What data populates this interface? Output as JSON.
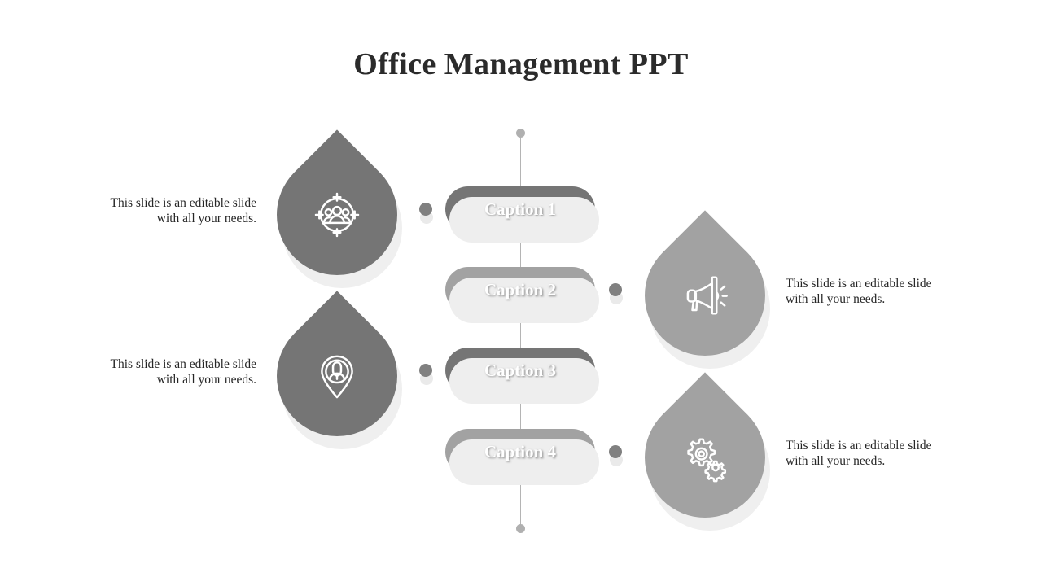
{
  "slide": {
    "title": "Office Management PPT",
    "background_color": "#ffffff",
    "title_color": "#2b2b2b",
    "accent_dark": "#757575",
    "accent_light": "#a2a2a2",
    "shadow_color": "#eeeeee",
    "spine_color": "#b4b4b4"
  },
  "captions": [
    {
      "label": "Caption 1",
      "tone": "dark",
      "color": "#757575"
    },
    {
      "label": "Caption 2",
      "tone": "light",
      "color": "#a2a2a2"
    },
    {
      "label": "Caption 3",
      "tone": "dark",
      "color": "#757575"
    },
    {
      "label": "Caption 4",
      "tone": "light",
      "color": "#a2a2a2"
    }
  ],
  "teardrops": [
    {
      "icon": "target-group-icon",
      "side": "left",
      "tone": "dark",
      "color": "#757575"
    },
    {
      "icon": "megaphone-icon",
      "side": "right",
      "tone": "light",
      "color": "#a2a2a2"
    },
    {
      "icon": "location-pin-person-icon",
      "side": "left",
      "tone": "dark",
      "color": "#757575"
    },
    {
      "icon": "gears-icon",
      "side": "right",
      "tone": "light",
      "color": "#a2a2a2"
    }
  ],
  "body_texts": [
    {
      "line1": "This slide is an editable slide",
      "line2": "with all your needs.",
      "align": "right"
    },
    {
      "line1": "This slide is an editable slide",
      "line2": "with all your needs.",
      "align": "left"
    },
    {
      "line1": "This slide is an editable slide",
      "line2": "with all your needs.",
      "align": "right"
    },
    {
      "line1": "This slide is an editable slide",
      "line2": "with all your needs.",
      "align": "left"
    }
  ],
  "connectors": [
    {
      "name": "connector-dot-1"
    },
    {
      "name": "connector-dot-2"
    },
    {
      "name": "connector-dot-3"
    },
    {
      "name": "connector-dot-4"
    }
  ]
}
